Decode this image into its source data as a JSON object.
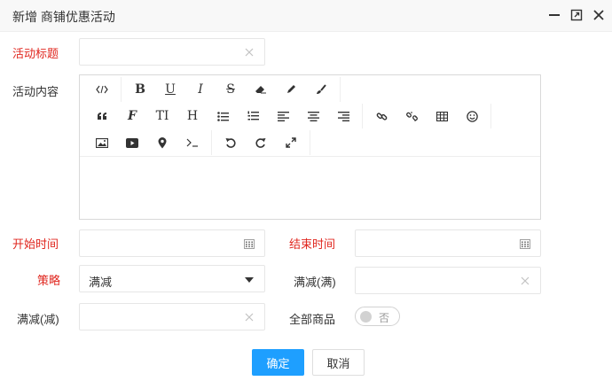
{
  "window": {
    "title": "新增 商铺优惠活动"
  },
  "form": {
    "activity_title_label": "活动标题",
    "activity_title_value": "",
    "activity_content_label": "活动内容",
    "start_time_label": "开始时间",
    "start_time_value": "",
    "end_time_label": "结束时间",
    "end_time_value": "",
    "strategy_label": "策略",
    "strategy_value": "满减",
    "full_threshold_label": "满减(满)",
    "full_threshold_value": "",
    "full_discount_label": "满减(减)",
    "full_discount_value": "",
    "all_goods_label": "全部商品",
    "all_goods_toggle_text": "否"
  },
  "toolbar": {
    "row1": [
      "code-icon",
      "bold-icon",
      "underline-icon",
      "italic-icon",
      "strikethrough-icon",
      "eraser-icon",
      "pencil-icon",
      "brush-icon"
    ],
    "row2": [
      "quote-icon",
      "font-icon",
      "text-size-icon",
      "heading-icon",
      "unordered-list-icon",
      "ordered-list-icon",
      "align-left-icon",
      "align-center-icon",
      "align-right-icon",
      "link-icon",
      "unlink-icon",
      "table-icon",
      "emoji-icon"
    ],
    "row3": [
      "image-icon",
      "video-icon",
      "location-icon",
      "terminal-icon",
      "undo-icon",
      "redo-icon",
      "fullscreen-icon"
    ],
    "glyphs": {
      "bold": "B",
      "underline": "U",
      "italic": "I",
      "strikethrough": "S",
      "heading": "H",
      "quote": "66",
      "font": "F",
      "text_size": "TI"
    }
  },
  "actions": {
    "confirm_label": "确定",
    "cancel_label": "取消"
  },
  "colors": {
    "required_label": "#e0271f",
    "primary_button": "#1e9fff"
  }
}
